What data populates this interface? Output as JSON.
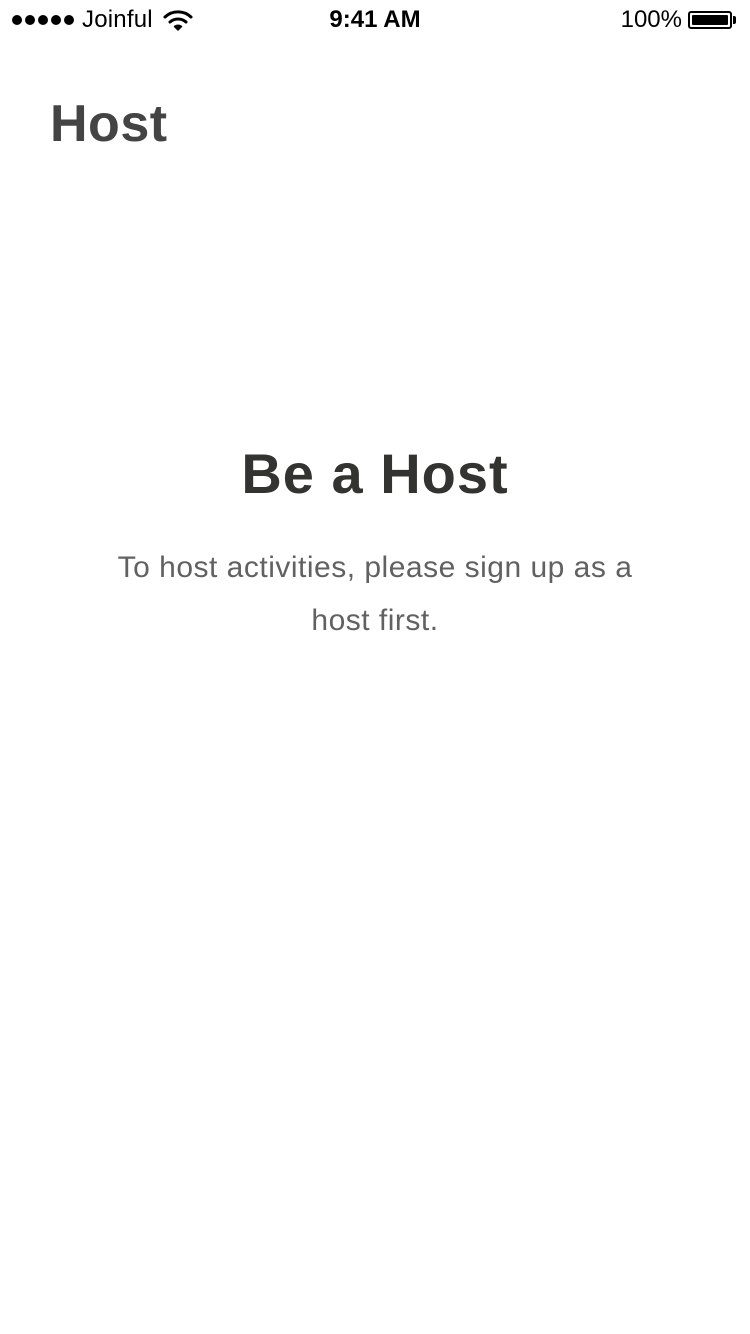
{
  "status_bar": {
    "carrier": "Joinful",
    "time": "9:41 AM",
    "battery_percent": "100%",
    "battery_level": 1.0,
    "signal_bars": 5,
    "icons": [
      "signal-dots-icon",
      "wifi-icon",
      "battery-icon"
    ]
  },
  "header": {
    "title": "Host"
  },
  "empty_state": {
    "title": "Be a Host",
    "message": "To host activities, please sign up as a host first."
  },
  "colors": {
    "background": "#ffffff",
    "title_text": "#444444",
    "heading_text": "#333331",
    "body_text": "#616161",
    "status_text": "#000000"
  }
}
